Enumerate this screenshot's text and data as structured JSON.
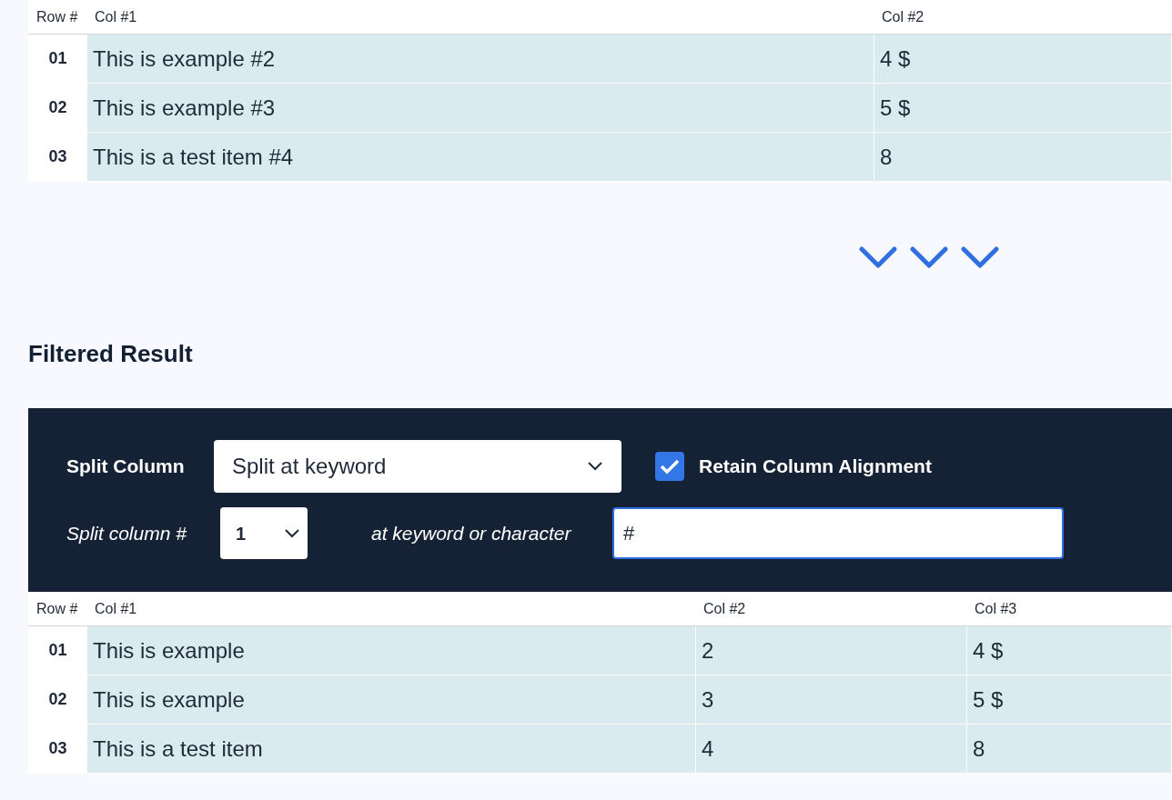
{
  "source_table": {
    "columns": [
      "Row #",
      "Col #1",
      "Col #2"
    ],
    "rows": [
      {
        "cells": [
          "01",
          "This is example #2",
          "4 $"
        ]
      },
      {
        "cells": [
          "02",
          "This is example #3",
          "5 $"
        ]
      },
      {
        "cells": [
          "03",
          "This is a test item #4",
          "8"
        ]
      }
    ]
  },
  "filtered_result": {
    "title": "Filtered Result",
    "controls": {
      "split_label": "Split Column",
      "split_mode": {
        "value": "Split at keyword"
      },
      "retain_alignment": {
        "label": "Retain Column Alignment",
        "checked": true
      },
      "column_number_label": "Split column #",
      "column_number": {
        "value": "1"
      },
      "keyword_label": "at keyword or character",
      "keyword": {
        "value": "#"
      }
    },
    "table": {
      "columns": [
        "Row #",
        "Col #1",
        "Col #2",
        "Col #3"
      ],
      "rows": [
        {
          "cells": [
            "01",
            "This is example",
            "2",
            "4 $"
          ]
        },
        {
          "cells": [
            "02",
            "This is example",
            "3",
            "5 $"
          ]
        },
        {
          "cells": [
            "03",
            "This is a test item",
            "4",
            "8"
          ]
        }
      ]
    }
  }
}
